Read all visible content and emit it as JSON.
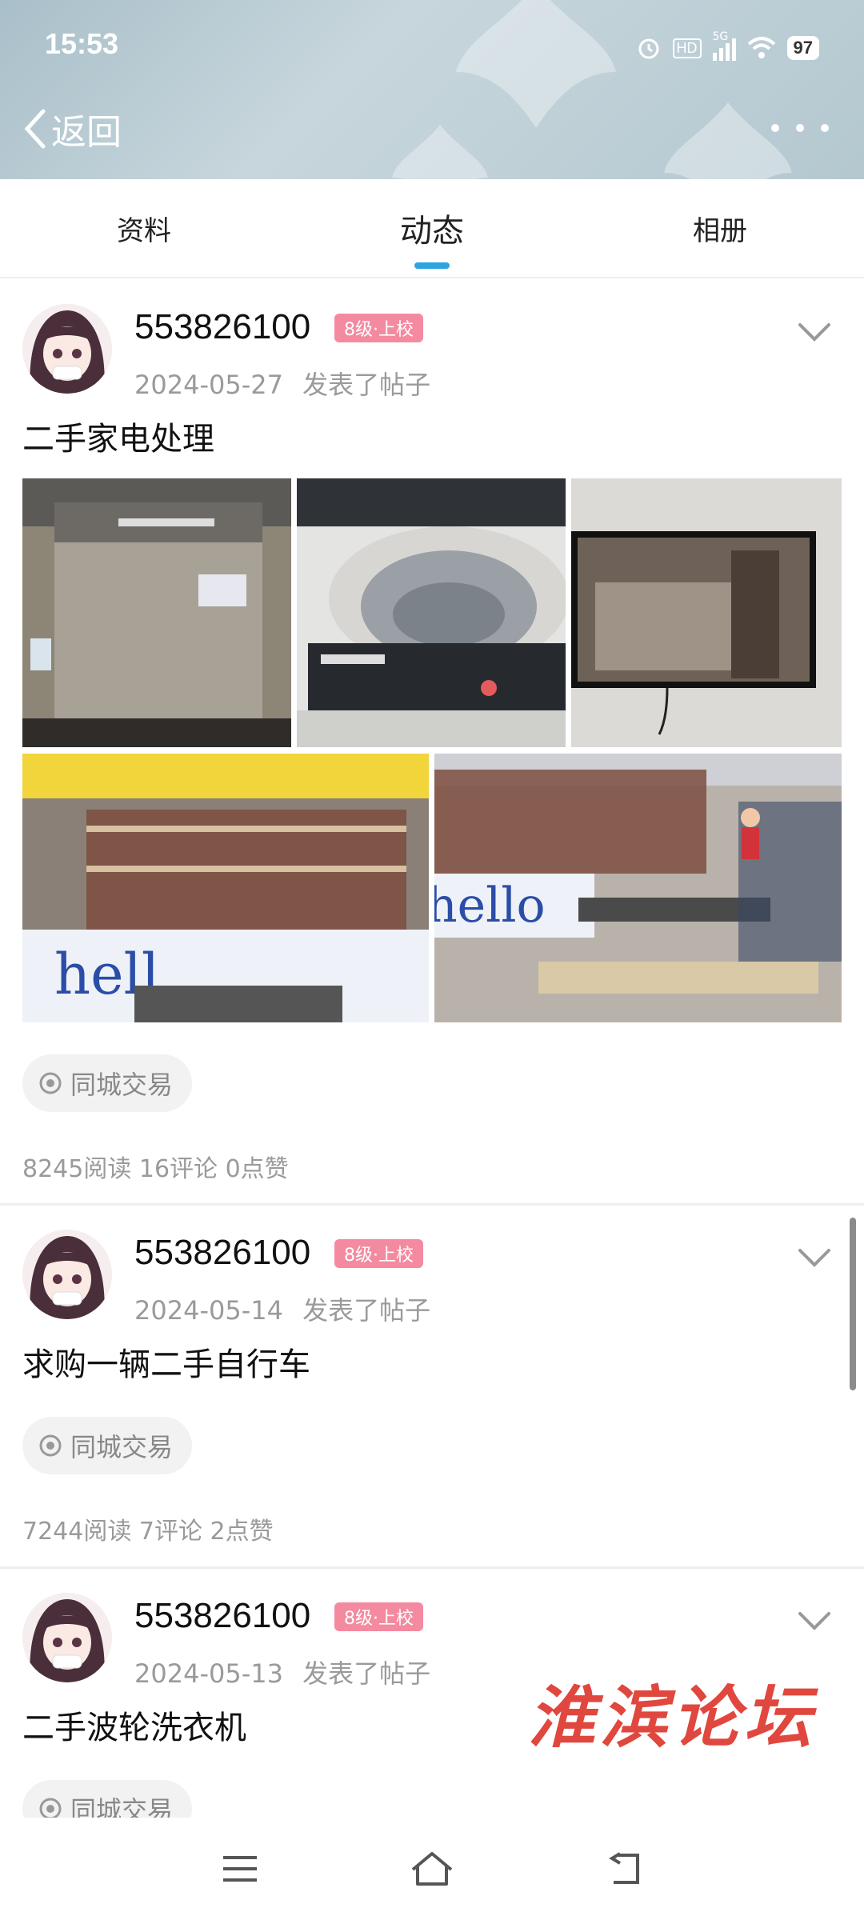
{
  "status_bar": {
    "time": "15:53",
    "network": "5G",
    "hd": "HD",
    "battery": "97"
  },
  "header": {
    "back_label": "返回",
    "more_icon": "more-dots-icon"
  },
  "tabs": [
    {
      "label": "资料",
      "active": false
    },
    {
      "label": "动态",
      "active": true
    },
    {
      "label": "相册",
      "active": false
    }
  ],
  "posts": [
    {
      "username": "553826100",
      "badge": "8级·上校",
      "date": "2024-05-27",
      "action": "发表了帖子",
      "title": "二手家电处理",
      "photos": [
        "washing-machine-front",
        "washing-machine-open",
        "wall-tv",
        "bbq-stall-sign",
        "bbq-stall-grill"
      ],
      "tag": "同城交易",
      "stats": "8245阅读 16评论 0点赞"
    },
    {
      "username": "553826100",
      "badge": "8级·上校",
      "date": "2024-05-14",
      "action": "发表了帖子",
      "title": "求购一辆二手自行车",
      "tag": "同城交易",
      "stats": "7244阅读 7评论 2点赞"
    },
    {
      "username": "553826100",
      "badge": "8级·上校",
      "date": "2024-05-13",
      "action": "发表了帖子",
      "title": "二手波轮洗衣机",
      "tag": "同城交易"
    }
  ],
  "watermark": "淮滨论坛",
  "nav": {
    "menu_icon": "menu-icon",
    "home_icon": "home-icon",
    "back_icon": "back-icon"
  },
  "colors": {
    "accent": "#2ea3e0",
    "badge": "#f48aa0",
    "watermark": "#e0473e"
  }
}
